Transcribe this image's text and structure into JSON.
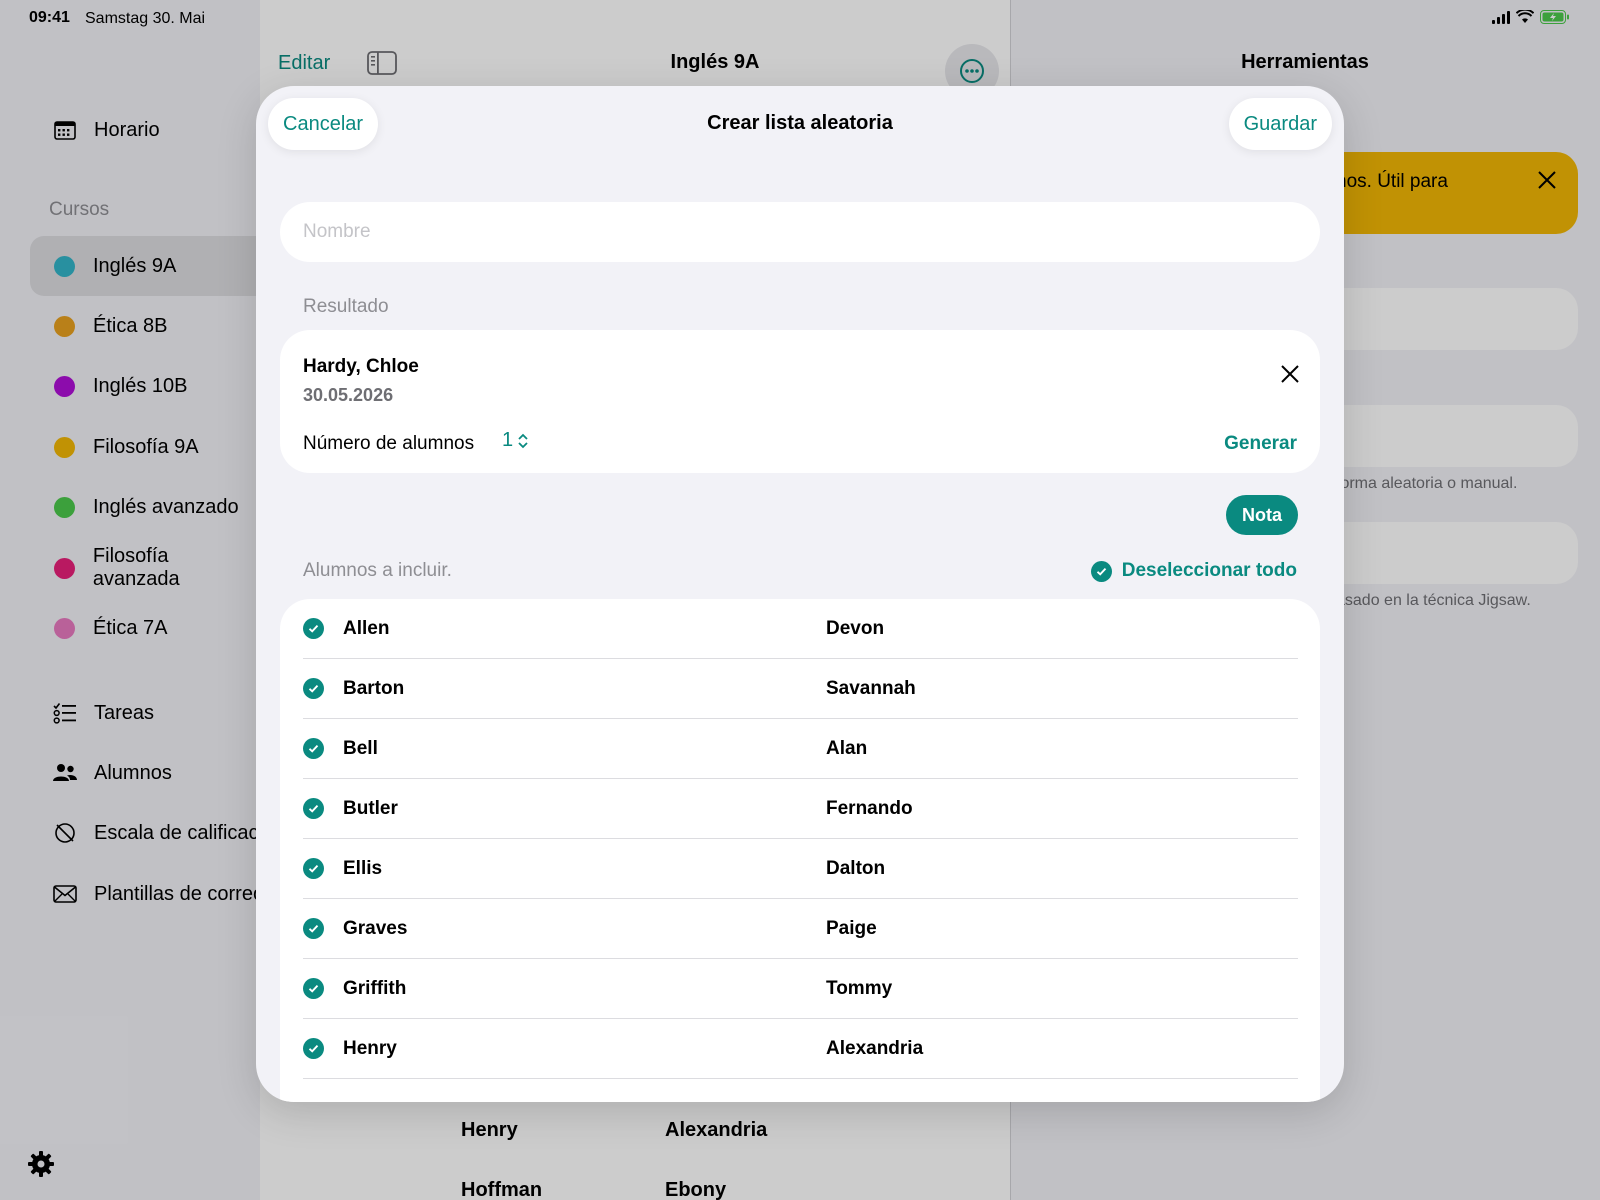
{
  "status_bar": {
    "time": "09:41",
    "date": "Samstag 30. Mai"
  },
  "sidebar": {
    "schedule_label": "Horario",
    "courses_header": "Cursos",
    "courses": [
      {
        "label": "Inglés 9A",
        "color": "#33b5c8",
        "active": true
      },
      {
        "label": "Ética 8B",
        "color": "#e8a020"
      },
      {
        "label": "Inglés 10B",
        "color": "#b010d8"
      },
      {
        "label": "Filosofía 9A",
        "color": "#f2b705"
      },
      {
        "label": "Inglés avanzado",
        "color": "#4cc94c"
      },
      {
        "label": "Filosofía avanzada",
        "color": "#e8207a"
      },
      {
        "label": "Ética 7A",
        "color": "#e87ac0"
      }
    ],
    "tasks_label": "Tareas",
    "students_label": "Alumnos",
    "grading_label": "Escala de calificac",
    "email_templates_label": "Plantillas de correo"
  },
  "navbar": {
    "edit_label": "Editar",
    "title": "Inglés 9A"
  },
  "tools_panel": {
    "title": "Herramientas",
    "banner_text": "nos. Útil para",
    "note_1": "forma aleatoria o manual.",
    "note_2": "asado en la técnica Jigsaw."
  },
  "background_rows": [
    {
      "last": "Henry",
      "first": "Alexandria"
    },
    {
      "last": "Hoffman",
      "first": "Ebony"
    }
  ],
  "modal": {
    "cancel_label": "Cancelar",
    "title": "Crear lista aleatoria",
    "save_label": "Guardar",
    "name_placeholder": "Nombre",
    "name_value": "",
    "result_header": "Resultado",
    "result": {
      "name": "Hardy, Chloe",
      "date": "30.05.2026"
    },
    "count_label": "Número de alumnos",
    "count_value": "1",
    "generate_label": "Generar",
    "note_label": "Nota",
    "include_header": "Alumnos a incluir.",
    "deselect_all_label": "Deseleccionar todo",
    "students": [
      {
        "last": "Allen",
        "first": "Devon",
        "checked": true
      },
      {
        "last": "Barton",
        "first": "Savannah",
        "checked": true
      },
      {
        "last": "Bell",
        "first": "Alan",
        "checked": true
      },
      {
        "last": "Butler",
        "first": "Fernando",
        "checked": true
      },
      {
        "last": "Ellis",
        "first": "Dalton",
        "checked": true
      },
      {
        "last": "Graves",
        "first": "Paige",
        "checked": true
      },
      {
        "last": "Griffith",
        "first": "Tommy",
        "checked": true
      },
      {
        "last": "Henry",
        "first": "Alexandria",
        "checked": true
      }
    ]
  },
  "colors": {
    "accent": "#0a8a80",
    "banner": "#f2b705"
  }
}
